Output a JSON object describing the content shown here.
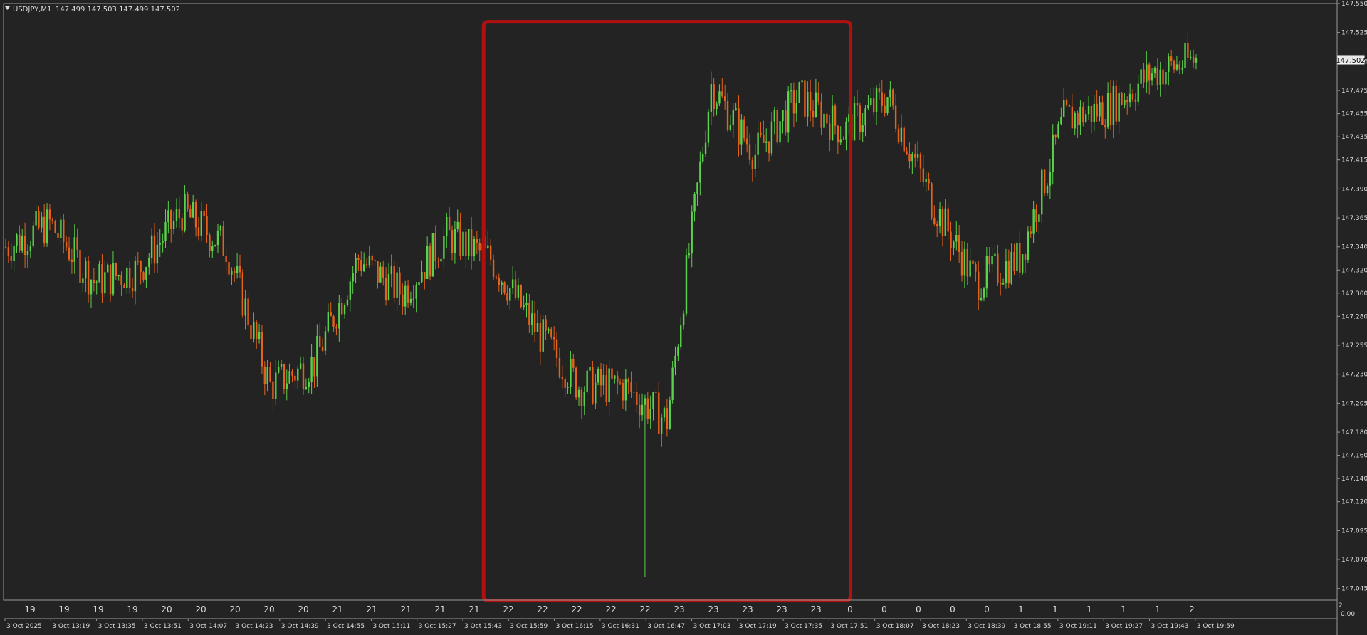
{
  "header": {
    "collapse_icon": "triangle-down-icon",
    "symbol": "USDJPY,M1",
    "ohlc": "147.499 147.503 147.499 147.502"
  },
  "colors": {
    "background": "#232323",
    "frame": "#9a9a9a",
    "bull": "#5ad24a",
    "bear": "#e6621b",
    "highlight": "#b01010",
    "text": "#dcdcdc"
  },
  "price_tag": "147.502",
  "corner_labels": [
    "2",
    "0.00"
  ],
  "hour_labels": [
    "19",
    "19",
    "19",
    "19",
    "20",
    "20",
    "20",
    "20",
    "20",
    "21",
    "21",
    "21",
    "21",
    "21",
    "22",
    "22",
    "22",
    "22",
    "22",
    "23",
    "23",
    "23",
    "23",
    "23",
    "0",
    "0",
    "0",
    "0",
    "0",
    "1",
    "1",
    "1",
    "1",
    "1",
    "2"
  ],
  "time_labels": [
    "3 Oct 2025",
    "3 Oct 13:19",
    "3 Oct 13:35",
    "3 Oct 13:51",
    "3 Oct 14:07",
    "3 Oct 14:23",
    "3 Oct 14:39",
    "3 Oct 14:55",
    "3 Oct 15:11",
    "3 Oct 15:27",
    "3 Oct 15:43",
    "3 Oct 15:59",
    "3 Oct 16:15",
    "3 Oct 16:31",
    "3 Oct 16:47",
    "3 Oct 17:03",
    "3 Oct 17:19",
    "3 Oct 17:35",
    "3 Oct 17:51",
    "3 Oct 18:07",
    "3 Oct 18:23",
    "3 Oct 18:39",
    "3 Oct 18:55",
    "3 Oct 19:11",
    "3 Oct 19:27",
    "3 Oct 19:43",
    "3 Oct 19:59"
  ],
  "chart_data": {
    "type": "line",
    "chart_style": "candlestick",
    "timeframe": "M1",
    "symbol": "USDJPY",
    "ylim": [
      147.035,
      147.55
    ],
    "yticks": [
      147.045,
      147.07,
      147.095,
      147.12,
      147.14,
      147.16,
      147.18,
      147.205,
      147.23,
      147.255,
      147.28,
      147.3,
      147.32,
      147.34,
      147.365,
      147.39,
      147.415,
      147.435,
      147.455,
      147.475,
      147.5,
      147.525,
      147.55
    ],
    "highlight": {
      "from": "3 Oct 15:59",
      "to": "3 Oct 17:51",
      "y_range": [
        147.05,
        147.525
      ]
    },
    "x": [
      "3 Oct 13:03",
      "3 Oct 13:19",
      "3 Oct 13:35",
      "3 Oct 13:51",
      "3 Oct 14:07",
      "3 Oct 14:23",
      "3 Oct 14:39",
      "3 Oct 14:55",
      "3 Oct 15:11",
      "3 Oct 15:27",
      "3 Oct 15:43",
      "3 Oct 15:59",
      "3 Oct 16:15",
      "3 Oct 16:31",
      "3 Oct 16:47",
      "3 Oct 16:55",
      "3 Oct 17:03",
      "3 Oct 17:19",
      "3 Oct 17:35",
      "3 Oct 17:51",
      "3 Oct 18:07",
      "3 Oct 18:23",
      "3 Oct 18:39",
      "3 Oct 18:55",
      "3 Oct 19:11",
      "3 Oct 19:27",
      "3 Oct 19:43",
      "3 Oct 19:55"
    ],
    "series": [
      {
        "values": [
          147.34,
          147.36,
          147.31,
          147.32,
          147.37,
          147.34,
          147.22,
          147.24,
          147.33,
          147.3,
          147.35,
          147.33,
          147.27,
          147.22,
          147.22,
          147.19,
          147.48,
          147.42,
          147.47,
          147.44,
          147.47,
          147.38,
          147.31,
          147.33,
          147.45,
          147.46,
          147.49,
          147.502
        ]
      }
    ]
  }
}
